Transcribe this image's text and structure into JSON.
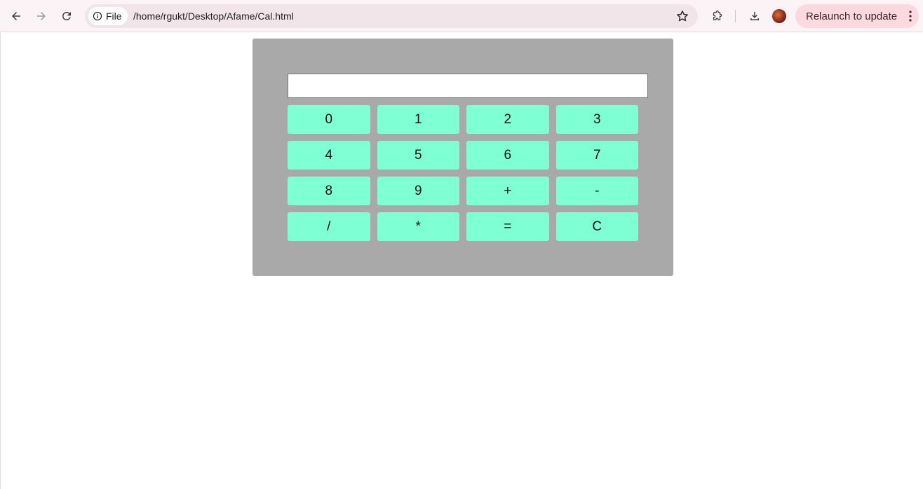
{
  "browser": {
    "site_chip_label": "File",
    "url": "/home/rgukt/Desktop/Afame/Cal.html",
    "relaunch_label": "Relaunch to update",
    "icons": {
      "back": "back-arrow-icon",
      "forward": "forward-arrow-icon",
      "reload": "reload-icon",
      "info": "info-icon",
      "bookmark": "star-icon",
      "extensions": "puzzle-icon",
      "downloads": "download-icon",
      "menu": "kebab-menu-icon"
    },
    "colors": {
      "toolbar_bg": "#fbf3f5",
      "omnibox_bg": "#f1e5e9",
      "relaunch_bg": "#fcd8df"
    }
  },
  "calculator": {
    "display_value": "",
    "keys": [
      {
        "label": "0"
      },
      {
        "label": "1"
      },
      {
        "label": "2"
      },
      {
        "label": "3"
      },
      {
        "label": "4"
      },
      {
        "label": "5"
      },
      {
        "label": "6"
      },
      {
        "label": "7"
      },
      {
        "label": "8"
      },
      {
        "label": "9"
      },
      {
        "label": "+"
      },
      {
        "label": "-"
      },
      {
        "label": "/"
      },
      {
        "label": "*"
      },
      {
        "label": "="
      },
      {
        "label": "C"
      }
    ],
    "colors": {
      "panel_bg": "#a9a9a9",
      "key_bg": "#7fffd4"
    }
  }
}
